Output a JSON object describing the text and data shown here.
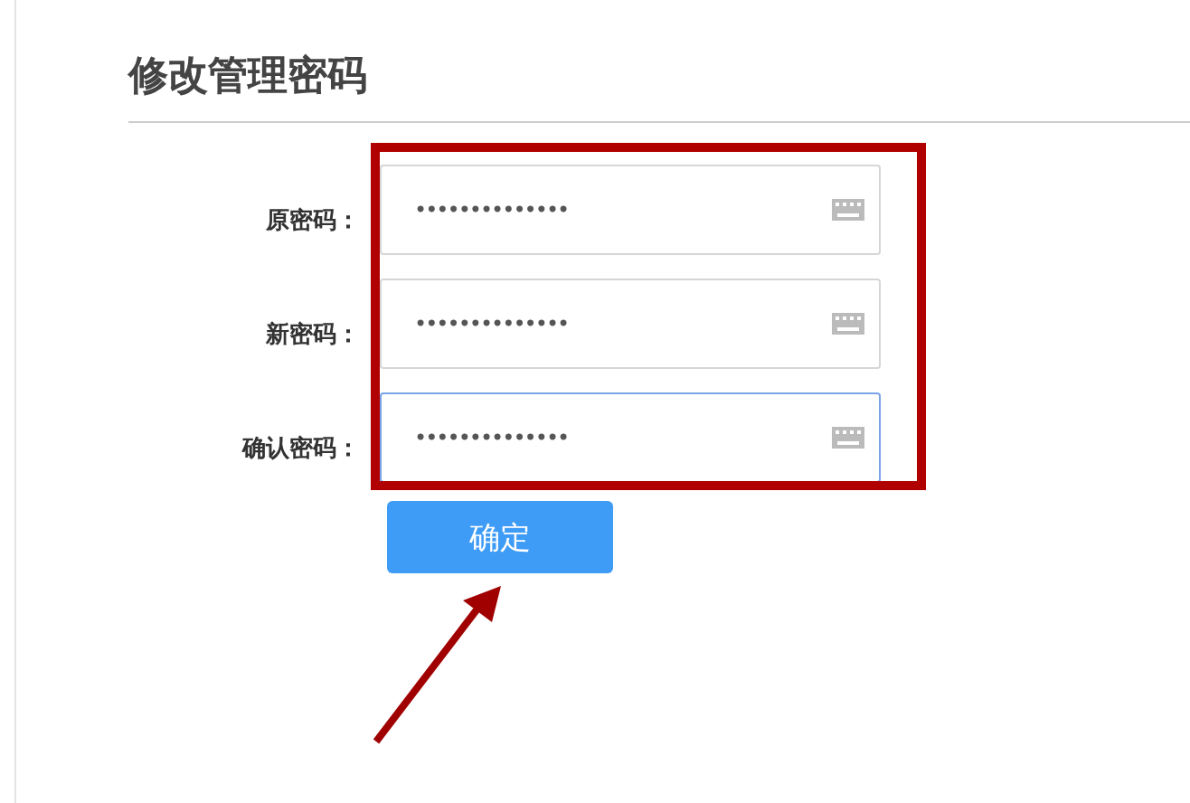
{
  "title": "修改管理密码",
  "fields": [
    {
      "label": "原密码：",
      "value": "••••••••••••••",
      "focused": false
    },
    {
      "label": "新密码：",
      "value": "••••••••••••••",
      "focused": false
    },
    {
      "label": "确认密码：",
      "value": "••••••••••••••",
      "focused": true
    }
  ],
  "submit": "确定"
}
